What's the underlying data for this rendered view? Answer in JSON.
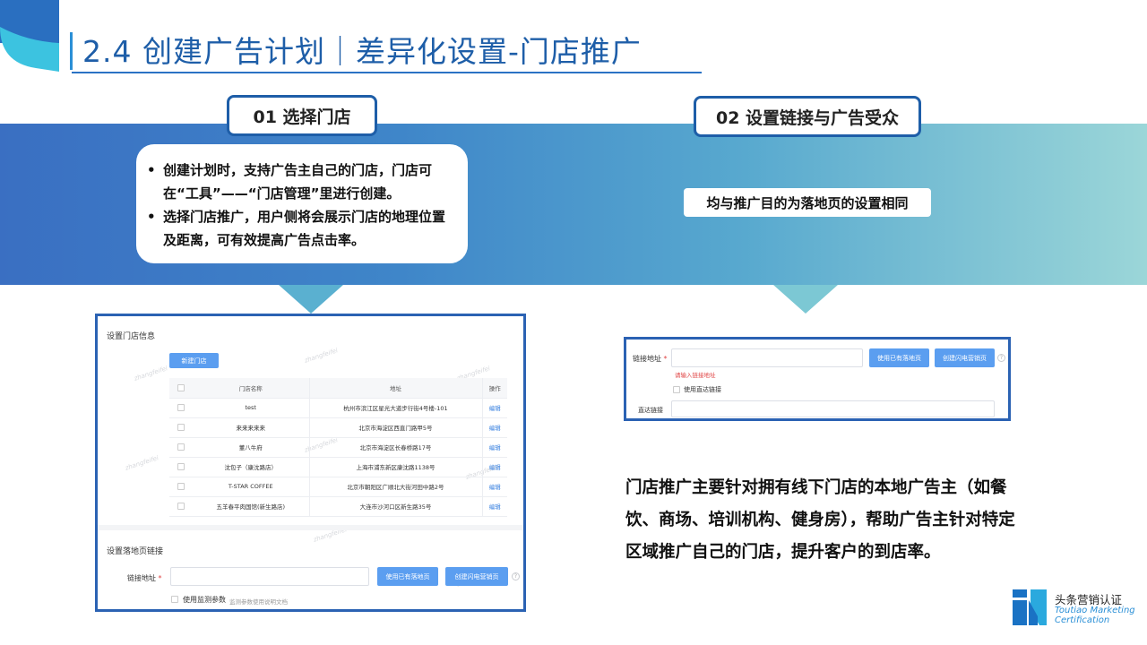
{
  "page": {
    "title": "2.4 创建广告计划｜差异化设置-门店推广",
    "step1_label": "01 选择门店",
    "step2_label": "02 设置链接与广告受众",
    "bullets": [
      "创建计划时，支持广告主自己的门店，门店可在“工具”——“门店管理”里进行创建。",
      "选择门店推广，用户侧将会展示门店的地理位置及距离，可有效提高广告点击率。"
    ],
    "right_note": "均与推广目的为落地页的设置相同",
    "description": "门店推广主要针对拥有线下门店的本地广告主（如餐饮、商场、培训机构、健身房），帮助广告主针对特定区域推广自己的门店，提升客户的到店率。"
  },
  "screenshot1": {
    "section_store": "设置门店信息",
    "new_store_button": "新建门店",
    "table": {
      "headers": [
        "",
        "门店名称",
        "地址",
        "操作"
      ],
      "rows": [
        {
          "name": "test",
          "address": "杭州市滨江区星光大道步行街4号楼-101",
          "op": "编辑"
        },
        {
          "name": "来来来来来",
          "address": "北京市海淀区西直门路甲5号",
          "op": "编辑"
        },
        {
          "name": "董八牛府",
          "address": "北京市海淀区长春桥路17号",
          "op": "编辑"
        },
        {
          "name": "沈包子（康沈路店）",
          "address": "上海市浦东新区康沈路1138号",
          "op": "编辑"
        },
        {
          "name": "T-STAR COFFEE",
          "address": "北京市朝阳区广顺北大街河田中路2号",
          "op": "编辑"
        },
        {
          "name": "五羊春平肉国馆(新生路店)",
          "address": "大连市沙河口区新生路35号",
          "op": "编辑"
        }
      ]
    },
    "section_landing": "设置落地页链接",
    "link_label": "链接地址",
    "required_mark": "*",
    "use_existing_button": "使用已有落地页",
    "create_flash_button": "创建闪电营销页",
    "help_mark": "?",
    "monitor_label": "使用监测参数",
    "monitor_doc": "监测参数使用说明文档",
    "watermark": "zhangfeifei"
  },
  "screenshot2": {
    "link_label": "链接地址",
    "required_mark": "*",
    "error_text": "请输入链接地址",
    "use_existing_button": "使用已有落地页",
    "create_flash_button": "创建闪电营销页",
    "help_mark": "?",
    "direct_checkbox_label": "使用直达链接",
    "direct_label": "直达链接"
  },
  "logo": {
    "cn": "头条营销认证",
    "en_line1": "Toutiao Marketing",
    "en_line2": "Certification"
  },
  "colors": {
    "title": "#1e5ea8",
    "band_start": "#3a6fc2",
    "band_end": "#9bd6d8",
    "panel_border": "#2b62b3",
    "primary_button": "#5b9ef0"
  }
}
